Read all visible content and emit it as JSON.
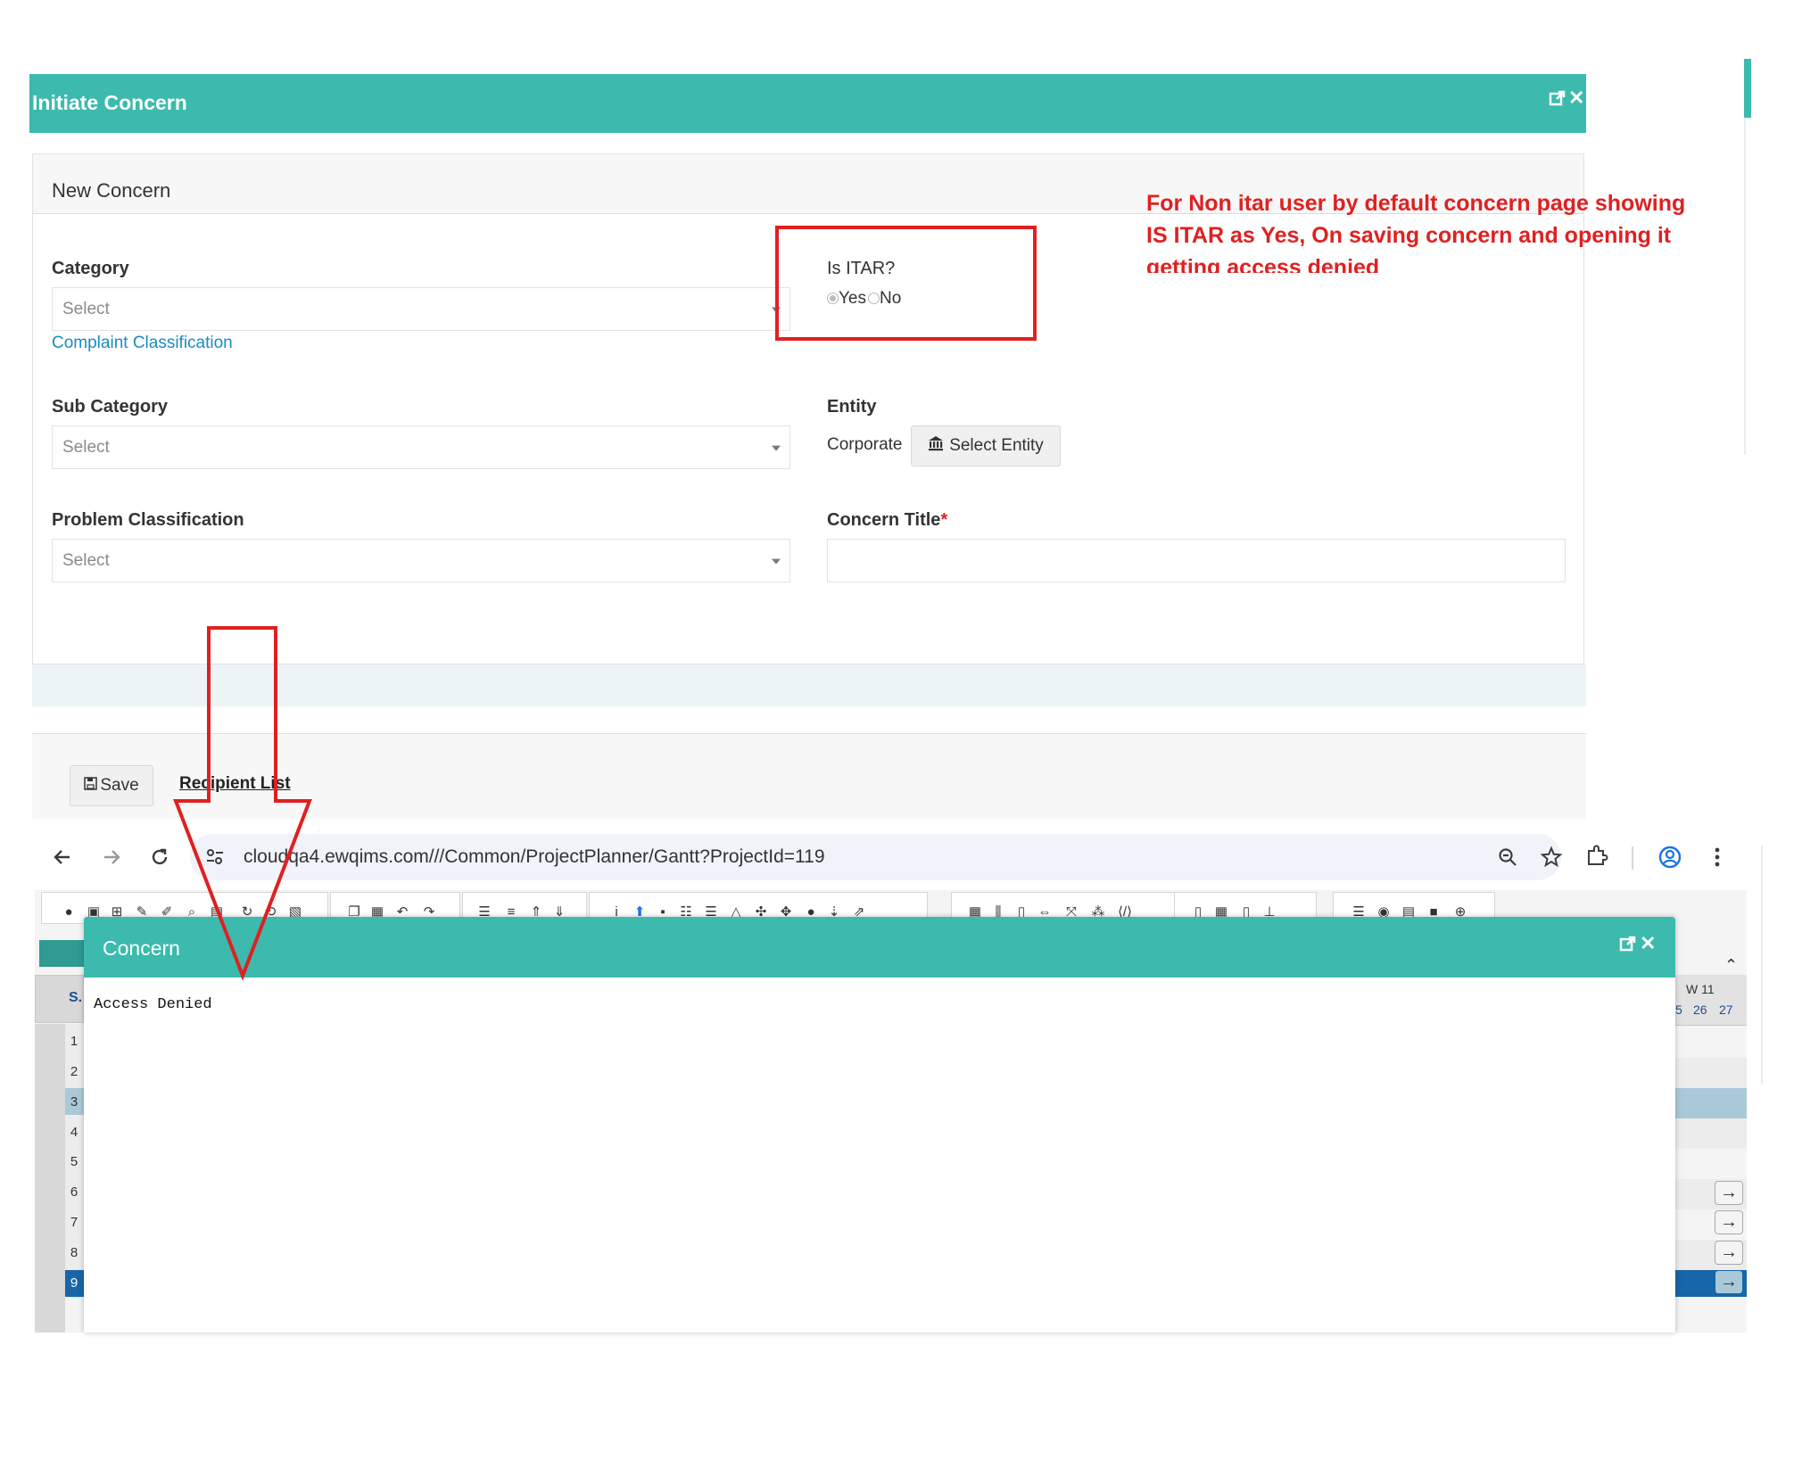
{
  "initiate_dialog": {
    "title": "Initiate Concern",
    "section_title": "New Concern",
    "category": {
      "label": "Category",
      "placeholder": "Select",
      "link": "Complaint Classification"
    },
    "itar": {
      "label": "Is ITAR?",
      "yes": "Yes",
      "no": "No",
      "selected": "Yes"
    },
    "sub_category": {
      "label": "Sub Category",
      "placeholder": "Select"
    },
    "entity": {
      "label": "Entity",
      "value": "Corporate",
      "button": "Select Entity"
    },
    "problem_classification": {
      "label": "Problem Classification",
      "placeholder": "Select"
    },
    "concern_title": {
      "label": "Concern Title",
      "required_mark": "*",
      "value": ""
    },
    "footer": {
      "save": "Save",
      "recipient_list": "Recipient List"
    }
  },
  "annotation": {
    "lines": [
      "For Non itar user by default concern page showing",
      "IS ITAR as Yes, On saving concern and opening it",
      "getting access denied"
    ],
    "color": "#e02020"
  },
  "browser": {
    "url": "cloudqa4.ewqims.com///Common/ProjectPlanner/Gantt?ProjectId=119",
    "icons": [
      "back-arrow-icon",
      "forward-arrow-icon",
      "reload-icon",
      "site-settings-icon",
      "zoom-icon",
      "star-icon",
      "extensions-icon",
      "profile-icon",
      "menu-icon"
    ]
  },
  "gantt": {
    "column_header": "S.",
    "week": "W 11",
    "days": [
      "5",
      "26",
      "27"
    ],
    "rows": [
      "1",
      "2",
      "3",
      "4",
      "5",
      "6",
      "7",
      "8",
      "9"
    ]
  },
  "concern_dialog": {
    "title": "Concern",
    "message": "Access Denied"
  },
  "colors": {
    "teal": "#3bbaad",
    "annotation_red": "#e02020",
    "selected_row": "#1766a8"
  }
}
